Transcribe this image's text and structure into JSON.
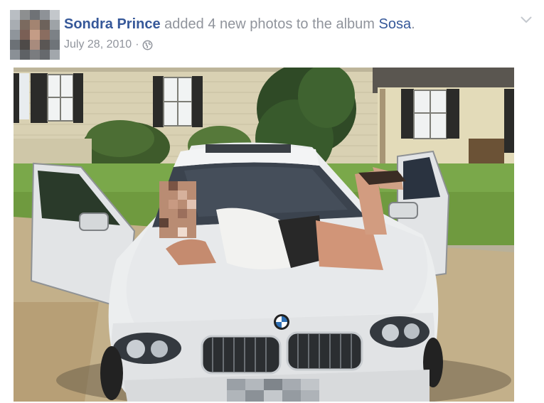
{
  "post": {
    "author_name": "Sondra Prince",
    "action_text": "added 4 new photos to the album",
    "album_name": "Sosa",
    "punctuation": ".",
    "date": "July 28, 2010",
    "date_separator": "·",
    "audience_icon": "globe-icon",
    "menu_icon": "chevron-down-icon"
  },
  "photo": {
    "content": "woman lying on the hood of a silver BMW sedan with open doors, parked in front of a cream house",
    "pixelated_regions": [
      "face",
      "license-plate"
    ]
  },
  "colors": {
    "link": "#365899",
    "meta_text": "#90949c",
    "background": "#ffffff"
  }
}
